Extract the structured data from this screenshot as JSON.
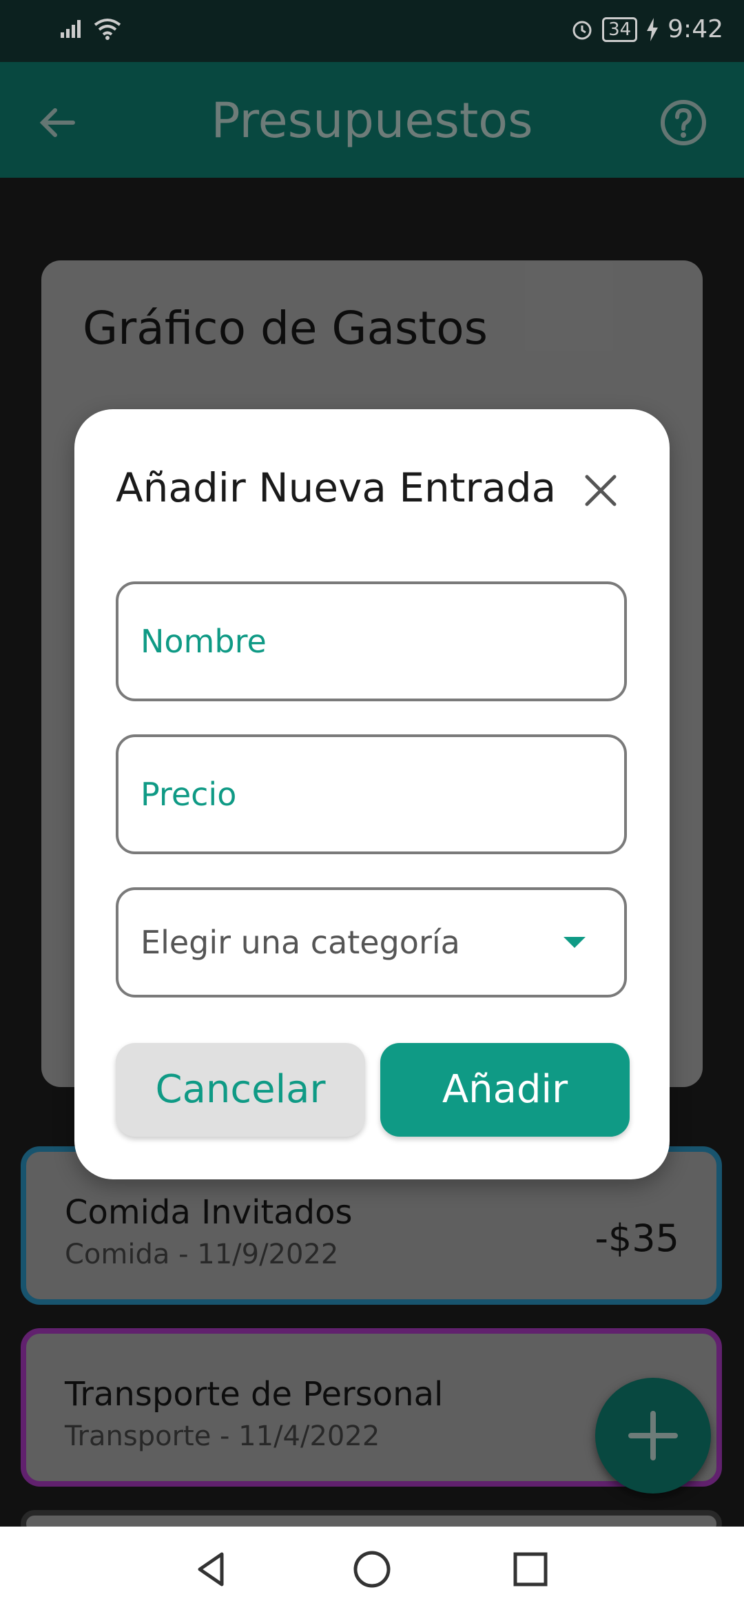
{
  "status": {
    "time": "9:42",
    "battery": "34"
  },
  "appbar": {
    "title": "Presupuestos"
  },
  "chart_card": {
    "title": "Gráfico de Gastos"
  },
  "entries": [
    {
      "name": "Comida Invitados",
      "sub": "Comida - 11/9/2022",
      "amount": "-$35",
      "border": "#1e6a8a"
    },
    {
      "name": "Transporte de Personal",
      "sub": "Transporte - 11/4/2022",
      "amount": "",
      "border": "#7a2a8a"
    }
  ],
  "dialog": {
    "title": "Añadir Nueva Entrada",
    "name_placeholder": "Nombre",
    "price_placeholder": "Precio",
    "category_placeholder": "Elegir una categoría",
    "cancel_label": "Cancelar",
    "add_label": "Añadir"
  },
  "colors": {
    "accent": "#0f9a85",
    "appbar": "#0a5a50"
  }
}
